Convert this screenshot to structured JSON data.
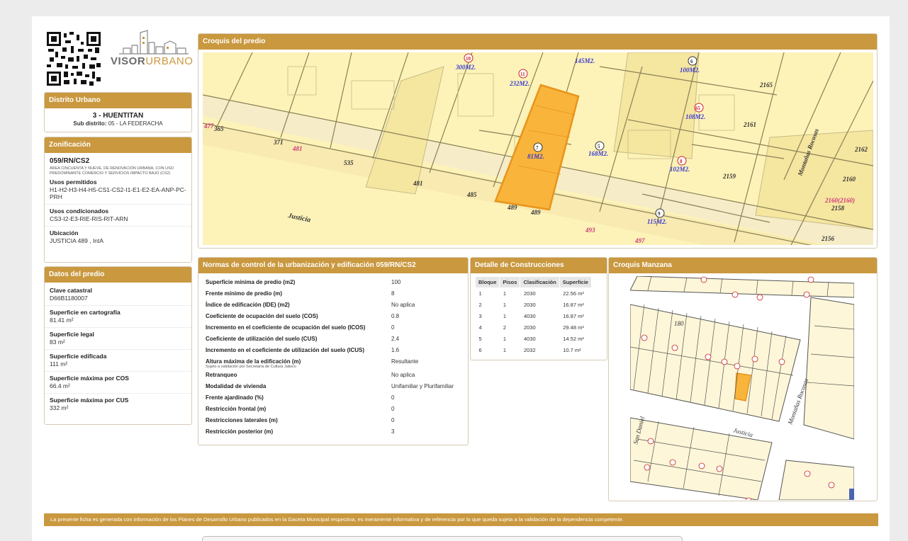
{
  "logo": {
    "brand_a": "VISOR",
    "brand_b": "URBANO"
  },
  "distrito": {
    "header": "Distrito Urbano",
    "title": "3 - HUENTITAN",
    "sub_label": "Sub distrito:",
    "sub_value": "05 - LA FEDERACHA"
  },
  "zonificacion": {
    "header": "Zonificación",
    "code": "059/RN/CS2",
    "description": "ÁREA CINCUENTA Y NUEVE, DE RENOVACIÓN URBANA, CON USO PREDOMINANTE COMERCIO Y SERVICIOS IMPACTO BAJO (CS2)",
    "items": [
      {
        "label": "Usos permitidos",
        "value": "H1-H2-H3-H4-H5-CS1-CS2-I1-E1-E2-EA-ANP-PC-PRH"
      },
      {
        "label": "Usos condicionados",
        "value": "CS3-I2-E3-RIE-RIS-RIT-ARN"
      },
      {
        "label": "Ubicación",
        "value": "JUSTICIA 489 , IntA"
      }
    ]
  },
  "predio": {
    "header": "Datos del predio",
    "items": [
      {
        "label": "Clave catastral",
        "value": "D66B1180007"
      },
      {
        "label": "Superficie en cartografía",
        "value": "81.41 m²"
      },
      {
        "label": "Superficie legal",
        "value": "83 m²"
      },
      {
        "label": "Superficie edificada",
        "value": "111 m²"
      },
      {
        "label": "Superficie máxima por COS",
        "value": "66.4 m²"
      },
      {
        "label": "Superficie máxima por CUS",
        "value": "332 m²"
      }
    ]
  },
  "croquis_predio": {
    "header": "Croquis del predio",
    "labels": {
      "l10": "10",
      "a300": "300M2.",
      "l11": "11",
      "a232": "232M2.",
      "a145": "145M2.",
      "l6": "6",
      "a100": "100M2.",
      "n2165": "2165",
      "l65": "65",
      "a108": "108M2.",
      "n2161": "2161",
      "n477": "477",
      "n365": "365",
      "n371": "371",
      "n481a": "481",
      "n535": "535",
      "l7": "7",
      "a81": "81M2.",
      "l5": "5",
      "a168": "168M2.",
      "l8": "8",
      "a102": "102M2.",
      "street_montanas": "Montañas Rocosas",
      "n2162": "2162",
      "n2160": "2160",
      "n481b": "481",
      "n485": "485",
      "n489a": "489",
      "n489b": "489",
      "n2159": "2159",
      "n21602160": "2160(2160)",
      "n2158": "2158",
      "street_justicia": "Justicia",
      "l9": "9",
      "a115": "115M2.",
      "n493": "493",
      "n497": "497",
      "n2156": "2156"
    }
  },
  "normas": {
    "header": "Normas de control de la urbanización y edificación 059/RN/CS2",
    "rows": [
      {
        "label": "Superficie mínima de predio (m2)",
        "value": "100"
      },
      {
        "label": "Frente mínimo de predio (m)",
        "value": "8"
      },
      {
        "label": "Índice de edificación (IDE) (m2)",
        "value": "No aplica"
      },
      {
        "label": "Coeficiente de ocupación del suelo (COS)",
        "value": "0.8"
      },
      {
        "label": "Incremento en el coeficiente de ocupación del suelo (ICOS)",
        "value": "0"
      },
      {
        "label": "Coeficiente de utilización del suelo (CUS)",
        "value": "2.4"
      },
      {
        "label": "Incremento en el coeficiente de utilización del suelo (ICUS)",
        "value": "1.6"
      },
      {
        "label": "Altura máxima de la edificación (m)",
        "note": "Sujeto a validación por Secretaría de Cultura Jalisco",
        "value": "Resultante"
      },
      {
        "label": "Retranqueo",
        "value": "No aplica"
      },
      {
        "label": "Modalidad de vivienda",
        "value": "Unifamiliar y Plurifamiliar"
      },
      {
        "label": "Frente ajardinado (%)",
        "value": "0"
      },
      {
        "label": "Restricción frontal (m)",
        "value": "0"
      },
      {
        "label": "Restricciones laterales (m)",
        "value": "0"
      },
      {
        "label": "Restricción posterior (m)",
        "value": "3"
      }
    ]
  },
  "detalle": {
    "header": "Detalle de Construcciones",
    "columns": [
      "Bloque",
      "Pisos",
      "Clasificación",
      "Superficie"
    ],
    "rows": [
      [
        "1",
        "1",
        "2030",
        "22.56 m²"
      ],
      [
        "2",
        "1",
        "2030",
        "16.87 m²"
      ],
      [
        "3",
        "1",
        "4030",
        "16.87 m²"
      ],
      [
        "4",
        "2",
        "2030",
        "29.48 m²"
      ],
      [
        "5",
        "1",
        "4030",
        "14.52 m²"
      ],
      [
        "6",
        "1",
        "2032",
        "10.7 m²"
      ]
    ]
  },
  "croquis_manzana": {
    "header": "Croquis Manzana",
    "labels": {
      "street_justicia": "Justicia",
      "street_montanas": "Montañas Rocosas",
      "street_sandaniel": "San Daniel",
      "n180": "180"
    }
  },
  "footer": "La presente ficha es generada con información de los Planes de Desarrollo Urbano publicados en la Gaceta Municipal respectiva, es meramente informativa y de referencia por lo que queda sujeta a la validación de la dependencia competente.",
  "colors": {
    "accent": "#c9983f",
    "lot_highlight": "#f9b43c",
    "map_base": "#fdf3b8"
  }
}
